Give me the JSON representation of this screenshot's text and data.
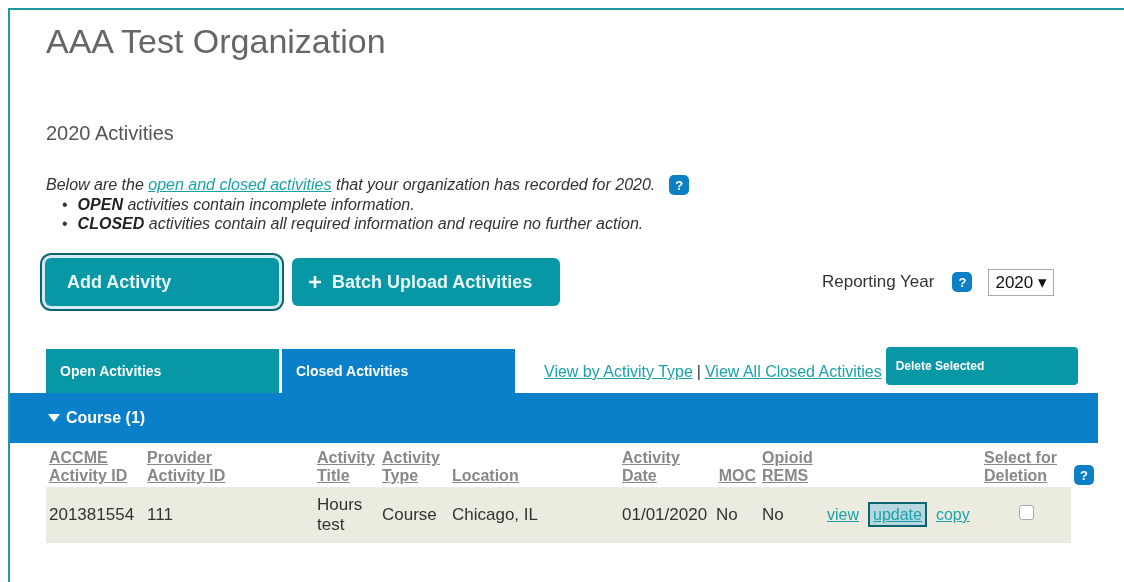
{
  "organization": {
    "title": "AAA Test Organization"
  },
  "page_heading": "2020 Activities",
  "intro": {
    "before": "Below are the ",
    "link": "open and closed activities",
    "after": " that your organization has recorded for 2020.",
    "help": "?"
  },
  "bullets": [
    {
      "marker": "•",
      "text": "**OPEN** activities contain incomplete information."
    },
    {
      "marker": "•",
      "text": "**CLOSED** activities contain all required information and require no further action."
    }
  ],
  "buttons": [
    {
      "kind": "plain",
      "label": "Add Activity",
      "focused": true
    },
    {
      "kind": "plus",
      "label": "Batch Upload Activities",
      "focused": false
    }
  ],
  "reporting_year": {
    "label": "Reporting Year",
    "help": "?",
    "value": "2020",
    "caret": "▾"
  },
  "tabs": [
    {
      "label": "Open Activities",
      "selected": false
    },
    {
      "label": "Closed Activities",
      "selected": true
    }
  ],
  "view_links": [
    "View by Activity Type",
    "View All Closed Activities"
  ],
  "link_separator": "|",
  "delete_button": "Delete Selected",
  "group": {
    "label": "Course (1)",
    "expanded": true
  },
  "table": {
    "help": "?",
    "columns": [
      "ACCME Activity ID",
      "Provider Activity ID",
      "Activity Title",
      "Activity Type",
      "Location",
      "Activity Date",
      "MOC",
      "Opioid REMS",
      "Select for Deletion"
    ],
    "rows": [
      {
        "cells": [
          "201381554",
          "111",
          "Hours test",
          "Course",
          "Chicago, IL",
          "01/01/2020",
          "No",
          "No"
        ],
        "actions": [
          {
            "label": "view",
            "focused": false
          },
          {
            "label": "update",
            "focused": true
          },
          {
            "label": "copy",
            "focused": false
          }
        ],
        "checked": false
      }
    ]
  }
}
